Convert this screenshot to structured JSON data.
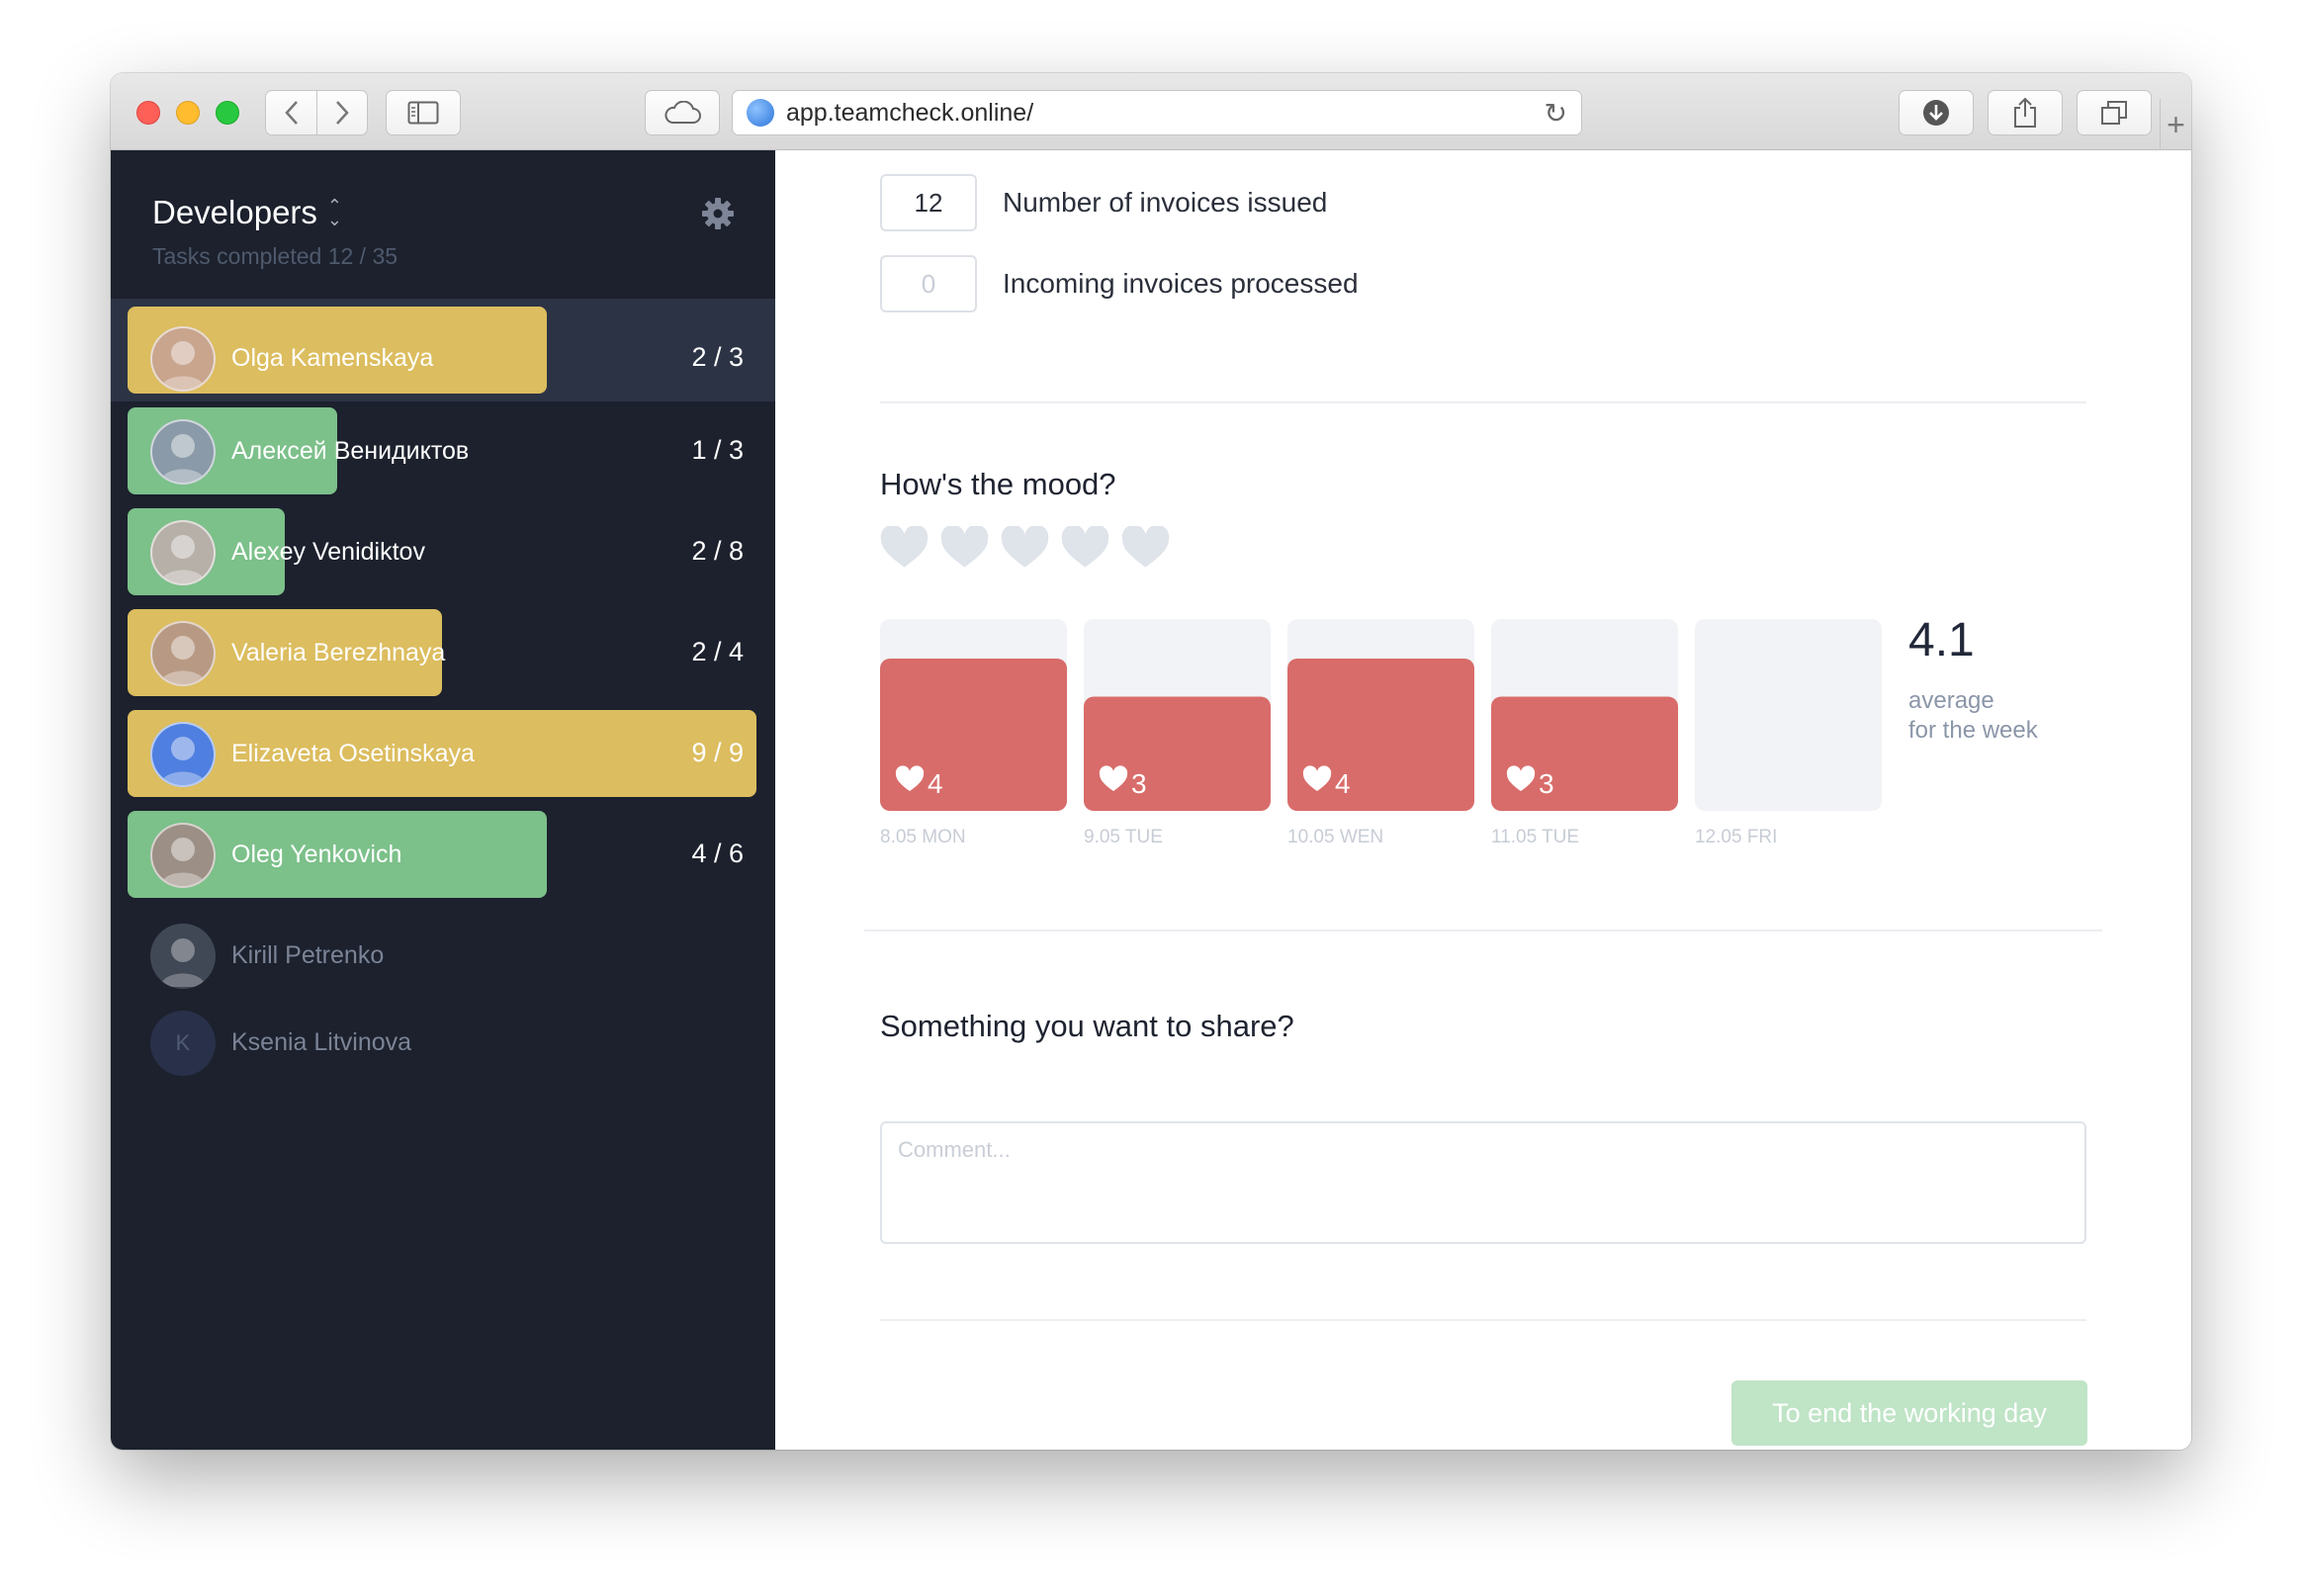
{
  "browser": {
    "url": "app.teamcheck.online/"
  },
  "sidebar": {
    "team_name": "Developers",
    "tasks_completed": "Tasks completed 12 / 35",
    "members": [
      {
        "name": "Olga Kamenskaya",
        "count": "2 / 3",
        "done": 2,
        "total": 3,
        "bar_color": "#dcbd5f",
        "avatar_color": "#c9a58e",
        "selected": true,
        "active": true
      },
      {
        "name": "Алексей Венидиктов",
        "count": "1 / 3",
        "done": 1,
        "total": 3,
        "bar_color": "#7cc08a",
        "avatar_color": "#8a9aa8",
        "selected": false,
        "active": true
      },
      {
        "name": "Alexey Venidiktov",
        "count": "2 / 8",
        "done": 2,
        "total": 8,
        "bar_color": "#7cc08a",
        "avatar_color": "#b7b0a9",
        "selected": false,
        "active": true
      },
      {
        "name": "Valeria Berezhnaya",
        "count": "2 / 4",
        "done": 2,
        "total": 4,
        "bar_color": "#dcbd5f",
        "avatar_color": "#b89a84",
        "selected": false,
        "active": true
      },
      {
        "name": "Elizaveta Osetinskaya",
        "count": "9 / 9",
        "done": 9,
        "total": 9,
        "bar_color": "#dcbd5f",
        "avatar_color": "#4f7fe0",
        "selected": false,
        "active": true
      },
      {
        "name": "Oleg Yenkovich",
        "count": "4 / 6",
        "done": 4,
        "total": 6,
        "bar_color": "#7cc08a",
        "avatar_color": "#9c8f85",
        "selected": false,
        "active": true
      },
      {
        "name": "Kirill Petrenko",
        "count": "",
        "done": 0,
        "total": 0,
        "bar_color": "",
        "avatar_color": "#4a5261",
        "selected": false,
        "active": false
      },
      {
        "name": "Ksenia Litvinova",
        "count": "",
        "done": 0,
        "total": 0,
        "bar_color": "",
        "avatar_color": "#2b3550",
        "avatar_letter": "K",
        "selected": false,
        "active": false
      }
    ]
  },
  "main": {
    "fields": [
      {
        "value": "12",
        "label": "Number of invoices issued",
        "empty": false
      },
      {
        "value": "0",
        "label": "Incoming invoices processed",
        "empty": true
      }
    ],
    "mood_title": "How's the mood?",
    "hearts_count": 5,
    "average_value": "4.1",
    "average_label_1": "average",
    "average_label_2": "for the week",
    "share_title": "Something you want to share?",
    "comment_placeholder": "Comment...",
    "end_day_label": "To end the working day"
  },
  "chart_data": {
    "type": "bar",
    "categories": [
      "8.05 MON",
      "9.05 TUE",
      "10.05 WEN",
      "11.05 TUE",
      "12.05 FRI"
    ],
    "values": [
      4,
      3,
      4,
      3,
      null
    ],
    "labels": [
      "4",
      "3",
      "4",
      "3",
      ""
    ],
    "ylim": [
      0,
      5
    ],
    "bar_color": "#d86c6a",
    "track_color": "#f2f3f6"
  }
}
